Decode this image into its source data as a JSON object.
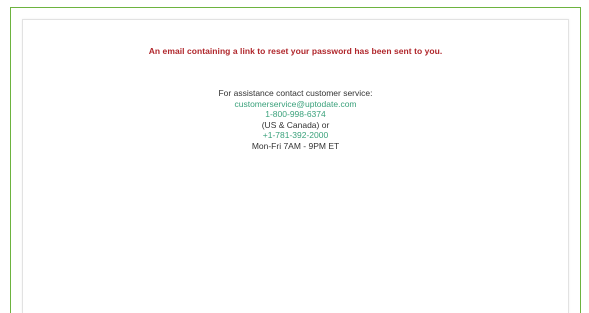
{
  "message": {
    "confirmation": "An email containing a link to reset your password has been sent to you."
  },
  "support": {
    "heading": "For assistance contact customer service:",
    "email": "customerservice@uptodate.com",
    "phone_us": "1-800-998-6374",
    "region_note": "(US & Canada) or",
    "phone_intl": "+1-781-392-2000",
    "hours": "Mon-Fri 7AM - 9PM ET"
  },
  "colors": {
    "frame_border": "#6db33f",
    "confirmation_text": "#b0262b",
    "link_text": "#3aa17b",
    "body_text": "#333333"
  }
}
